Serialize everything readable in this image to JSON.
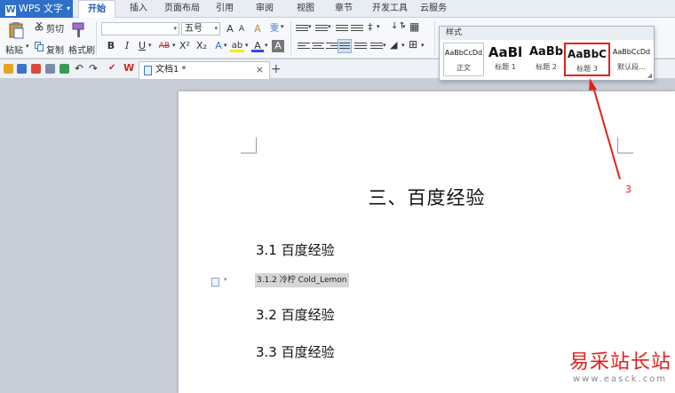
{
  "app": {
    "logo_text": "WPS 文字",
    "logo_mark": "W"
  },
  "menu": {
    "tabs": [
      "开始",
      "插入",
      "页面布局",
      "引用",
      "审阅",
      "视图",
      "章节",
      "开发工具",
      "云服务"
    ]
  },
  "ribbon": {
    "paste_label": "粘贴",
    "cut_label": "剪切",
    "copy_label": "复制",
    "format_painter_label": "格式刷",
    "font_name_value": "",
    "font_size_value": "五号",
    "bold": "B",
    "italic": "I",
    "underline": "U",
    "strike": "AB",
    "superscript": "X²",
    "subscript": "X₂",
    "grow_font": "A",
    "shrink_font": "A",
    "clear_format": "A",
    "phonetic": "雯",
    "font_color": "A",
    "highlight": "ab",
    "shade": "A"
  },
  "quickbar": {
    "doc_tab_title": "文档1 *",
    "close_symbol": "×",
    "add_symbol": "+"
  },
  "styles_popup": {
    "title": "样式",
    "items": [
      {
        "sample": "AaBbCcDd",
        "name": "正文"
      },
      {
        "sample": "AaBl",
        "name": "标题 1"
      },
      {
        "sample": "AaBb",
        "name": "标题 2"
      },
      {
        "sample": "AaBbC",
        "name": "标题 3"
      },
      {
        "sample": "AaBbCcDd",
        "name": "默认段..."
      }
    ]
  },
  "document": {
    "title": "三、百度经验",
    "h2_1": "3.1 百度经验",
    "h3_selected": "3.1.2 冷柠 Cold_Lemon",
    "h2_2": "3.2 百度经验",
    "h2_3": "3.3 百度经验"
  },
  "annotation": {
    "number": "3"
  },
  "watermark": {
    "cn": "易采站长站",
    "url": "www.easck.com"
  },
  "colors": {
    "accent": "#2e6fc7",
    "highlight_red": "#e2211c"
  }
}
